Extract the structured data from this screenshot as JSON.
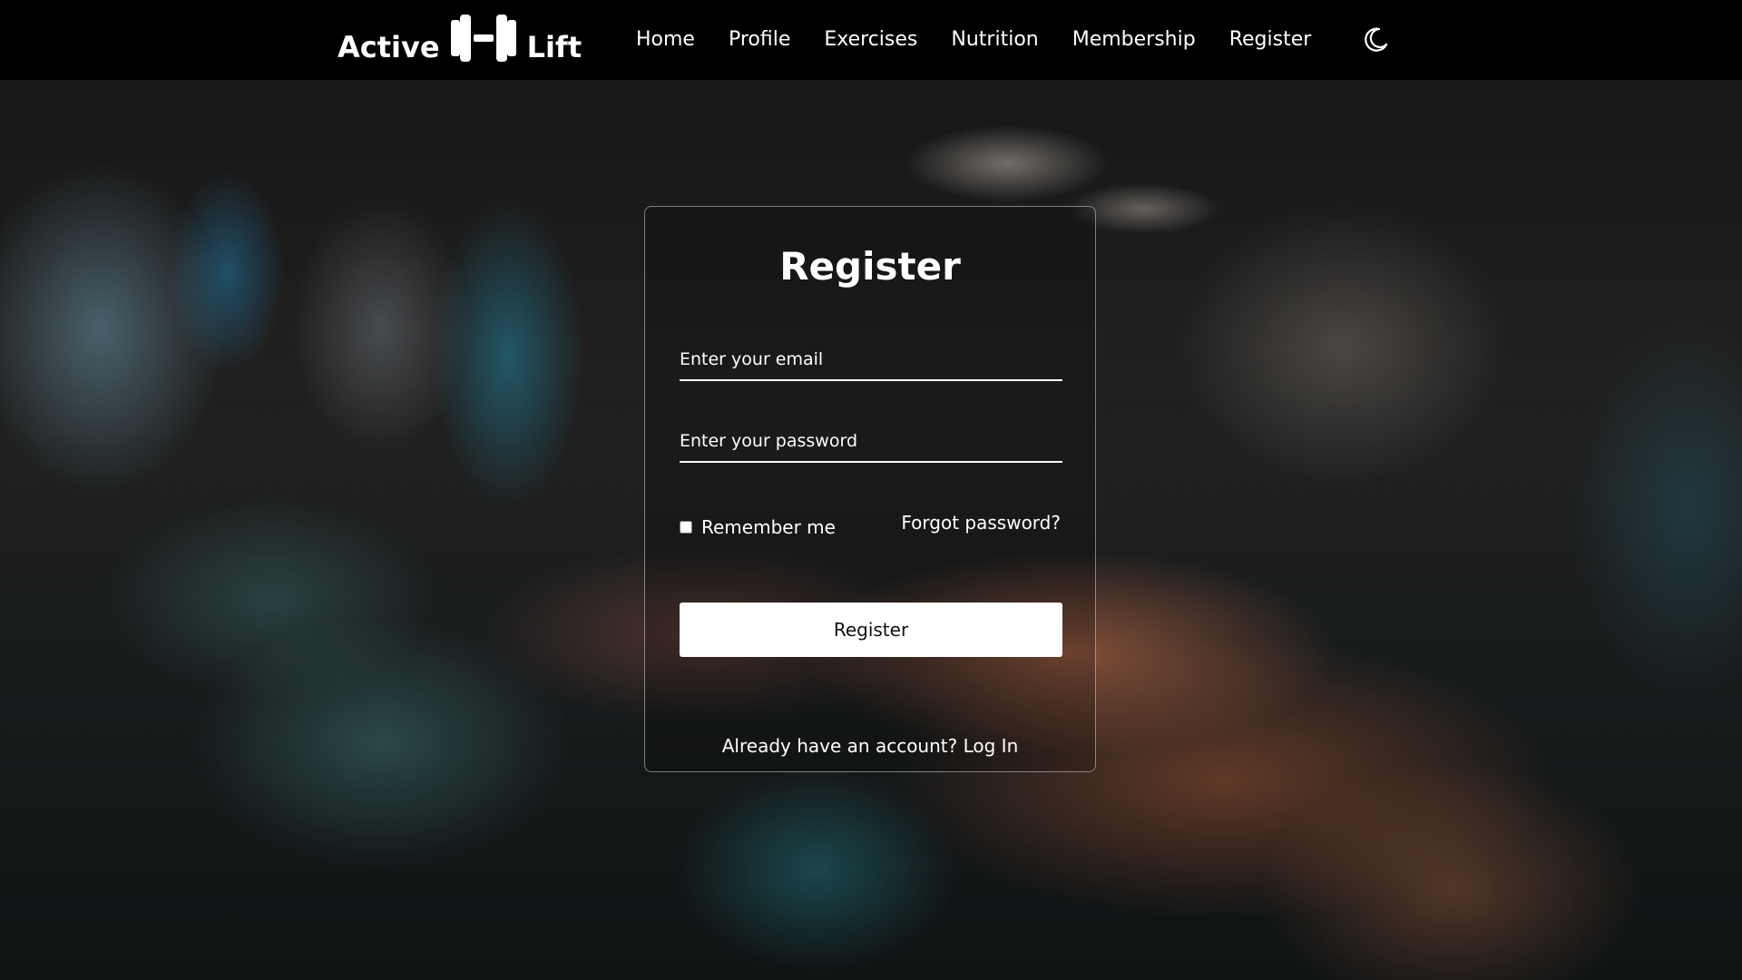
{
  "brand": {
    "name_left": "Active",
    "name_right": "Lift",
    "icon": "dumbbell-icon"
  },
  "nav": {
    "items": [
      {
        "label": "Home"
      },
      {
        "label": "Profile"
      },
      {
        "label": "Exercises"
      },
      {
        "label": "Nutrition"
      },
      {
        "label": "Membership"
      },
      {
        "label": "Register"
      }
    ],
    "theme_toggle_icon": "moon-icon"
  },
  "form": {
    "title": "Register",
    "email_placeholder": "Enter your email",
    "email_value": "",
    "password_placeholder": "Enter your password",
    "password_value": "",
    "remember_label": "Remember me",
    "remember_checked": false,
    "forgot_label": "Forgot password?",
    "submit_label": "Register",
    "login_prompt": "Already have an account?",
    "login_link": "Log In"
  },
  "colors": {
    "navbar_bg": "#000000",
    "text": "#ffffff",
    "button_bg": "#ffffff",
    "button_text": "#111111"
  }
}
